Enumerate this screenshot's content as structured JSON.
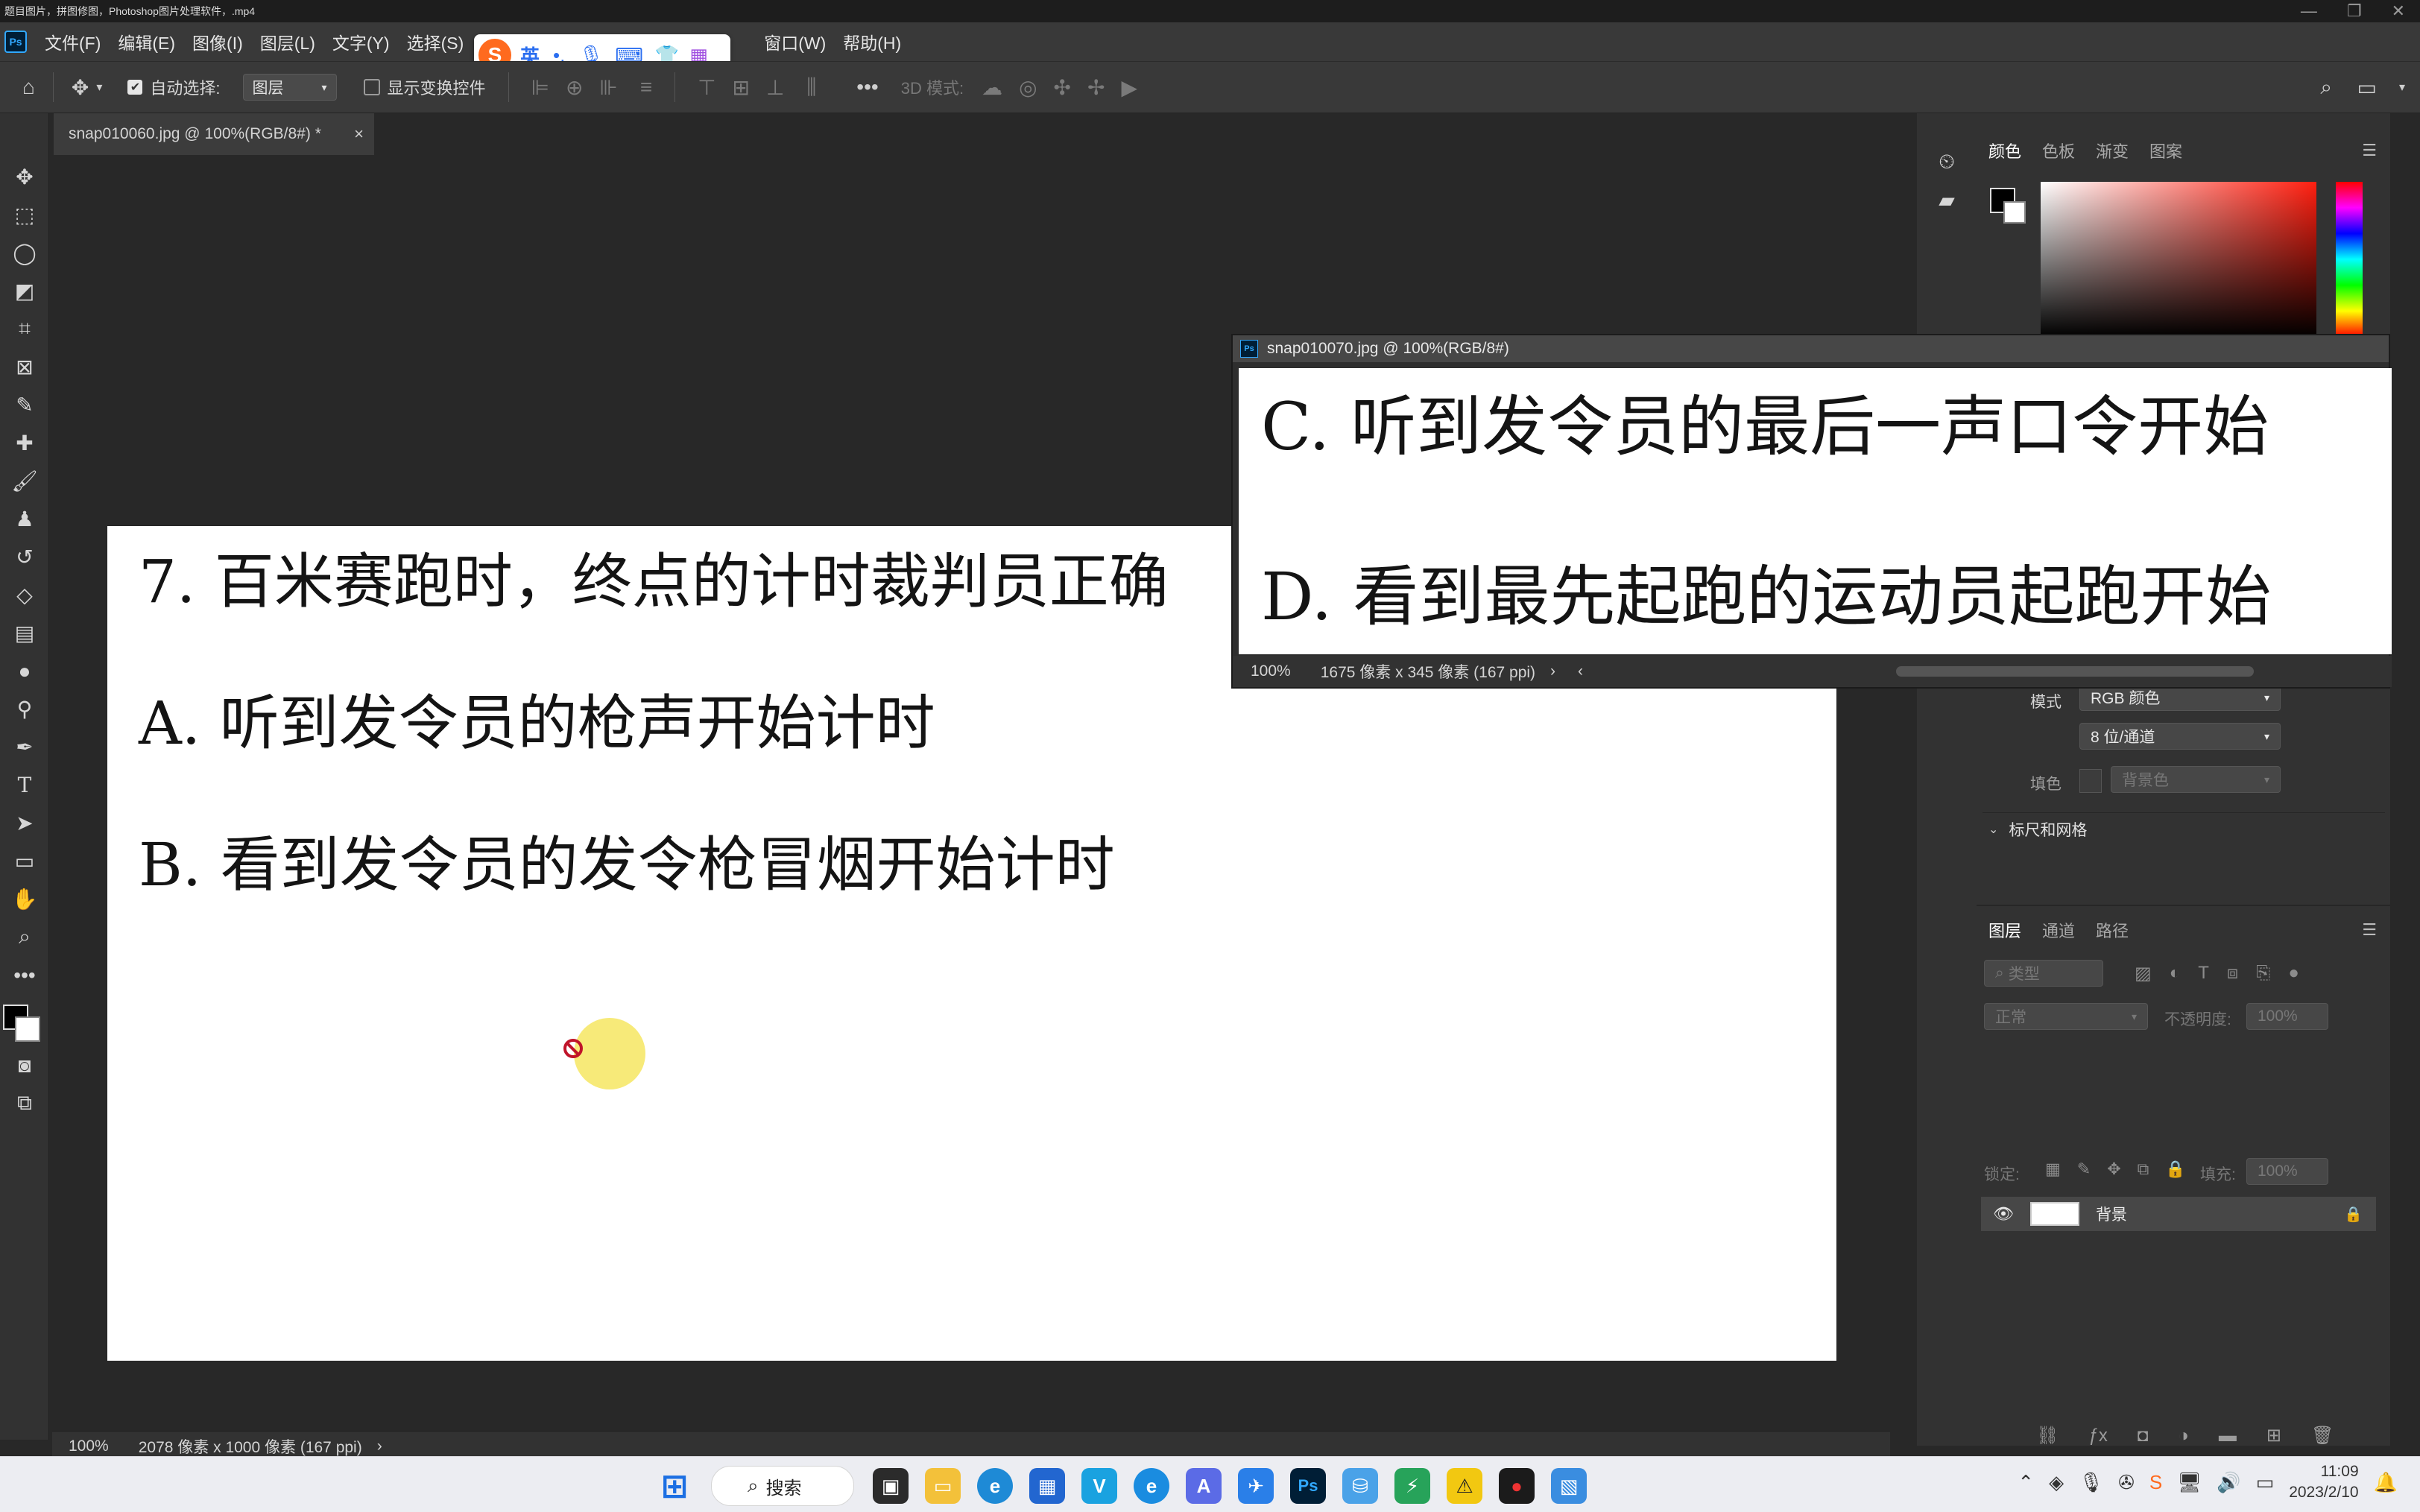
{
  "titlebar": {
    "title": "题目图片，拼图修图，Photoshop图片处理软件，.mp4"
  },
  "app": {
    "logo": "Ps"
  },
  "menu": [
    "文件(F)",
    "编辑(E)",
    "图像(I)",
    "图层(L)",
    "文字(Y)",
    "选择(S)",
    "窗口(W)",
    "帮助(H)"
  ],
  "options": {
    "auto_select_label": "自动选择:",
    "auto_select_value": "图层",
    "show_transform_label": "显示变换控件",
    "mode_3d_label": "3D 模式:"
  },
  "document": {
    "tab_title": "snap010060.jpg @ 100%(RGB/8#) *",
    "zoom": "100%",
    "size_info": "2078 像素 x 1000 像素 (167 ppi)",
    "lines": [
      "7. 百米赛跑时，终点的计时裁判员正确",
      "A. 听到发令员的枪声开始计时",
      "B. 看到发令员的发令枪冒烟开始计时"
    ]
  },
  "floating_window": {
    "title": "snap010070.jpg @ 100%(RGB/8#)",
    "zoom": "100%",
    "size_info": "1675 像素 x 345 像素 (167 ppi)",
    "lines": [
      "C. 听到发令员的最后一声口令开始",
      "D. 看到最先起跑的运动员起跑开始"
    ]
  },
  "color_panel": {
    "tabs": [
      "颜色",
      "色板",
      "渐变",
      "图案"
    ]
  },
  "properties_panel": {
    "mode_label": "模式",
    "mode_value": "RGB 颜色",
    "depth_value": "8 位/通道",
    "fill_label": "填色",
    "fill_value": "背景色",
    "ruler_section": "标尺和网格"
  },
  "layers_panel": {
    "tabs": [
      "图层",
      "通道",
      "路径"
    ],
    "filter_placeholder": "类型",
    "blend_mode": "正常",
    "opacity_label": "不透明度:",
    "opacity_value": "100%",
    "lock_label": "锁定:",
    "fill_label": "填充:",
    "fill_value": "100%",
    "layers": [
      {
        "name": "背景"
      }
    ]
  },
  "taskbar": {
    "search_label": "搜索",
    "time": "11:09",
    "date": "2023/2/10"
  },
  "ime": {
    "lang": "英"
  },
  "colors": {
    "ps_blue": "#31a8ff",
    "accent_yellow": "#f6e86a",
    "panel": "#323232"
  }
}
